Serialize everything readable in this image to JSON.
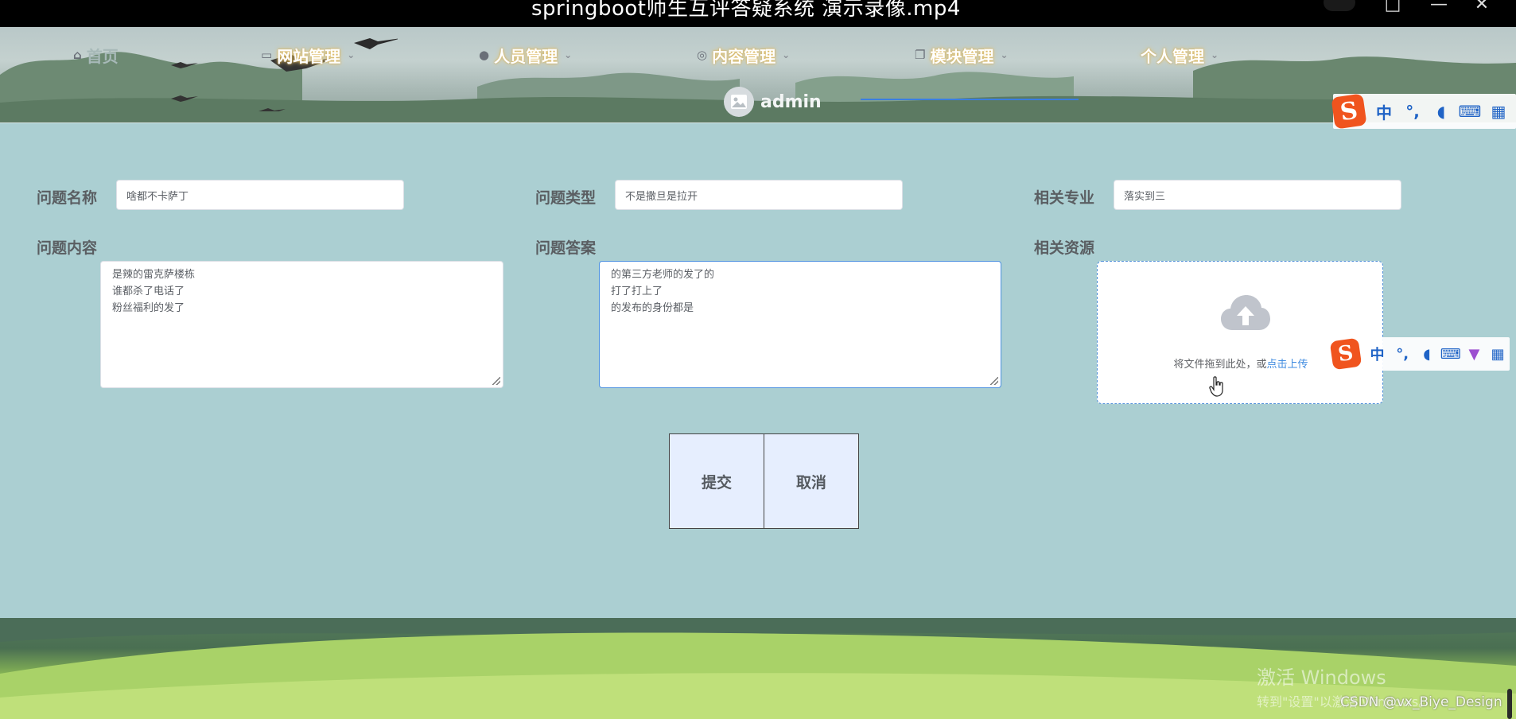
{
  "window": {
    "title": "springboot师生互评答疑系统 演示录像.mp4"
  },
  "nav": {
    "items": [
      {
        "label": "首页"
      },
      {
        "label": "网站管理"
      },
      {
        "label": "人员管理"
      },
      {
        "label": "内容管理"
      },
      {
        "label": "模块管理"
      },
      {
        "label": "个人管理"
      }
    ],
    "active_index": 4
  },
  "user": {
    "name": "admin"
  },
  "ime": {
    "mode_label": "中",
    "punct_label": "°,"
  },
  "form": {
    "name": {
      "label": "问题名称",
      "value": "啥都不卡萨丁"
    },
    "type": {
      "label": "问题类型",
      "value": "不是撒旦是拉开"
    },
    "major": {
      "label": "相关专业",
      "value": "落实到三"
    },
    "content": {
      "label": "问题内容",
      "value": "是辣的雷克萨楼栋\n谁都杀了电话了\n粉丝福利的发了"
    },
    "answer": {
      "label": "问题答案",
      "value": "的第三方老师的发了的\n打了打上了\n的发布的身份都是"
    },
    "resource": {
      "label": "相关资源",
      "hint": "将文件拖到此处，或",
      "link": "点击上传"
    }
  },
  "buttons": {
    "submit": "提交",
    "cancel": "取消"
  },
  "overlay": {
    "activate_title": "激活 Windows",
    "activate_sub": "转到\"设置\"以激活 Windows。",
    "watermark": "CSDN @vx_Biye_Design"
  },
  "colors": {
    "accent": "#3a7ee0",
    "page_bg": "#abcfd2",
    "button_bg": "#e6eefe",
    "ime_brand": "#f0541e"
  }
}
